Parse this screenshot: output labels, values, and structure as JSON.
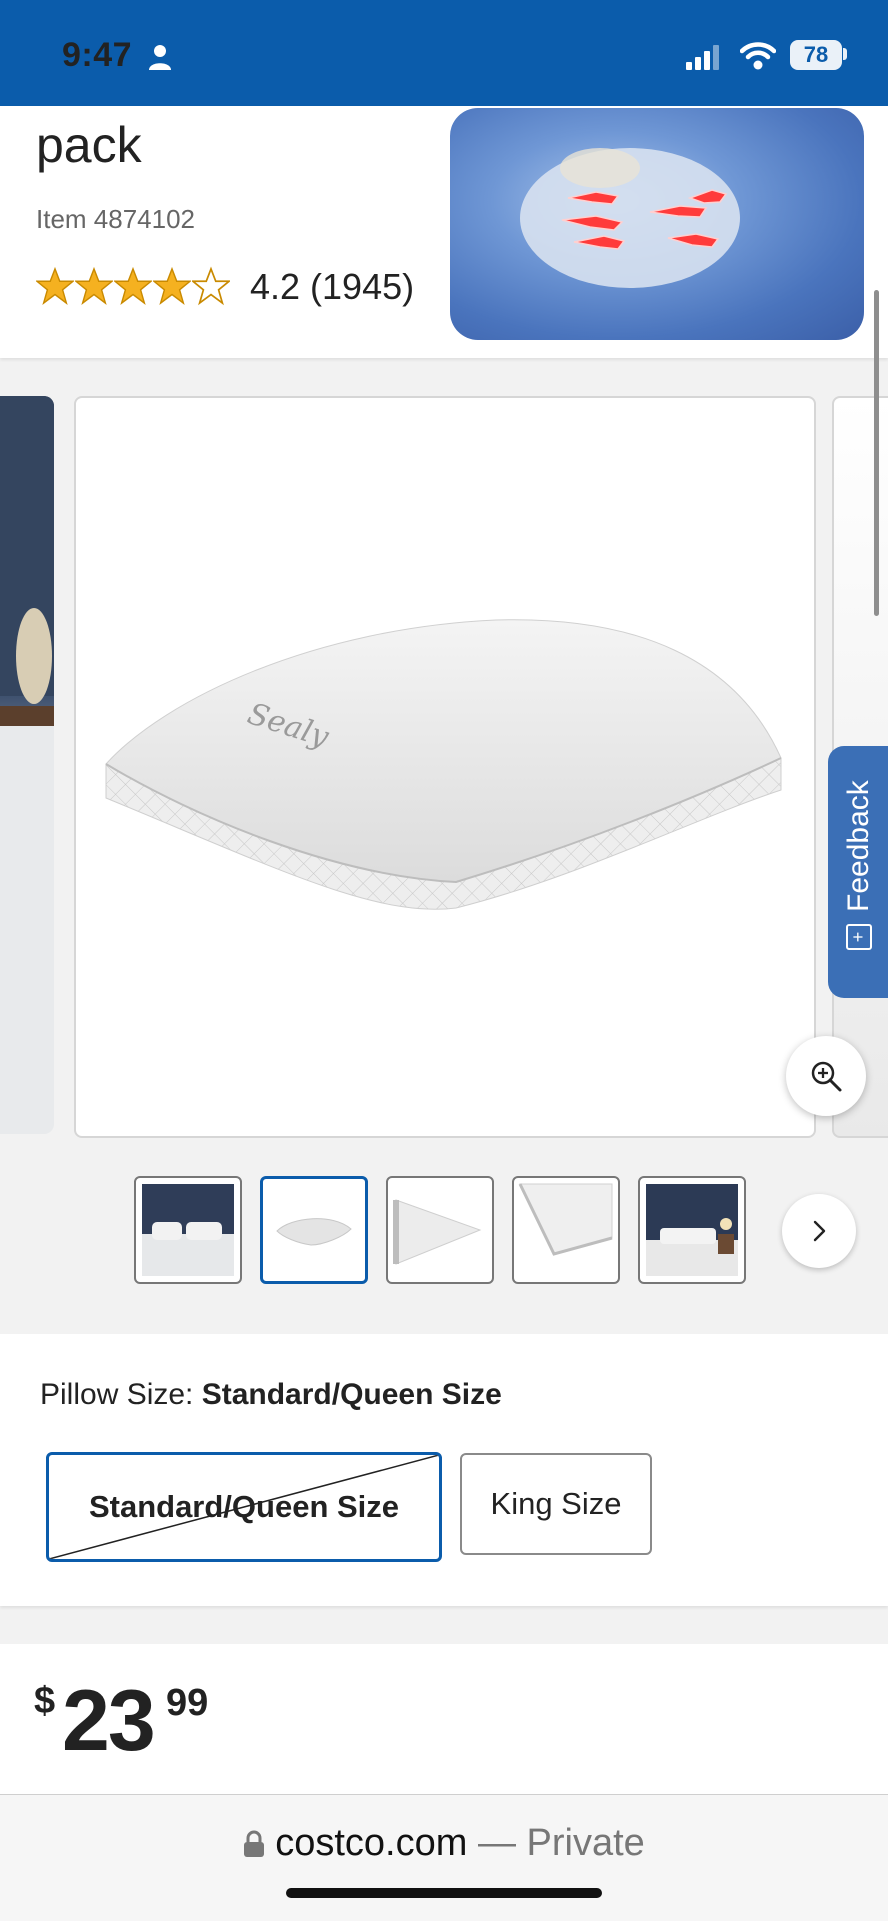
{
  "status_bar": {
    "time": "9:47",
    "battery": "78"
  },
  "product": {
    "title": "pack",
    "item_number": "Item 4874102",
    "rating": 4.2,
    "rating_text": "4.2 (1945)",
    "star_icons": [
      "star-full-icon",
      "star-full-icon",
      "star-full-icon",
      "star-full-icon",
      "star-empty-icon"
    ],
    "image_brand": "Sealy"
  },
  "gallery": {
    "feedback_label": "Feedback",
    "feedback_plus": "+",
    "thumbnails": [
      "bed-room-thumb",
      "pillow-front-thumb",
      "pillow-side-thumb",
      "pillow-corner-thumb",
      "bedroom-wide-thumb"
    ],
    "selected_index": 1
  },
  "options": {
    "label": "Pillow Size: ",
    "selected_value": "Standard/Queen Size",
    "choices": [
      "Standard/Queen Size",
      "King Size"
    ]
  },
  "price": {
    "currency": "$",
    "dollars": "23",
    "cents": "99"
  },
  "browser": {
    "domain": "costco.com",
    "suffix": " — Private"
  },
  "colors": {
    "brand_blue": "#0b5cab",
    "star": "#f5b120",
    "feedback_tab": "#3b6fb6"
  }
}
